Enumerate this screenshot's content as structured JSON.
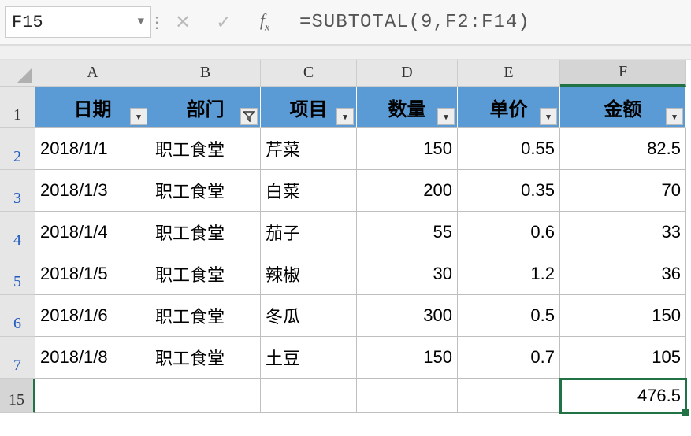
{
  "formula_bar": {
    "name_box": "F15",
    "cancel_glyph": "✕",
    "confirm_glyph": "✓",
    "fx_label_f": "f",
    "fx_label_x": "x",
    "formula": "=SUBTOTAL(9,F2:F14)"
  },
  "col_headers": [
    "A",
    "B",
    "C",
    "D",
    "E",
    "F"
  ],
  "row_headers": [
    "1",
    "2",
    "3",
    "4",
    "5",
    "6",
    "7",
    "15"
  ],
  "headers": {
    "A": "日期",
    "B": "部门",
    "C": "项目",
    "D": "数量",
    "E": "单价",
    "F": "金额"
  },
  "rows": [
    {
      "A": "2018/1/1",
      "B": "职工食堂",
      "C": "芹菜",
      "D": "150",
      "E": "0.55",
      "F": "82.5"
    },
    {
      "A": "2018/1/3",
      "B": "职工食堂",
      "C": "白菜",
      "D": "200",
      "E": "0.35",
      "F": "70"
    },
    {
      "A": "2018/1/4",
      "B": "职工食堂",
      "C": "茄子",
      "D": "55",
      "E": "0.6",
      "F": "33"
    },
    {
      "A": "2018/1/5",
      "B": "职工食堂",
      "C": "辣椒",
      "D": "30",
      "E": "1.2",
      "F": "36"
    },
    {
      "A": "2018/1/6",
      "B": "职工食堂",
      "C": "冬瓜",
      "D": "300",
      "E": "0.5",
      "F": "150"
    },
    {
      "A": "2018/1/8",
      "B": "职工食堂",
      "C": "土豆",
      "D": "150",
      "E": "0.7",
      "F": "105"
    }
  ],
  "subtotal": {
    "F": "476.5"
  },
  "filter_glyph": "▾",
  "funnel_glyph": "⧩"
}
